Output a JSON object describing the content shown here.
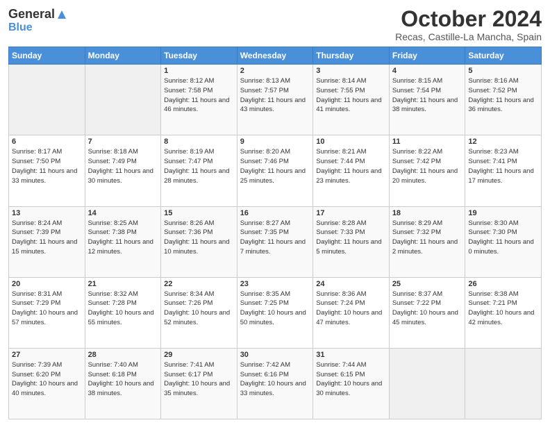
{
  "header": {
    "logo_general": "General",
    "logo_blue": "Blue",
    "month_title": "October 2024",
    "location": "Recas, Castille-La Mancha, Spain"
  },
  "weekdays": [
    "Sunday",
    "Monday",
    "Tuesday",
    "Wednesday",
    "Thursday",
    "Friday",
    "Saturday"
  ],
  "weeks": [
    [
      {
        "day": "",
        "info": ""
      },
      {
        "day": "",
        "info": ""
      },
      {
        "day": "1",
        "info": "Sunrise: 8:12 AM\nSunset: 7:58 PM\nDaylight: 11 hours and 46 minutes."
      },
      {
        "day": "2",
        "info": "Sunrise: 8:13 AM\nSunset: 7:57 PM\nDaylight: 11 hours and 43 minutes."
      },
      {
        "day": "3",
        "info": "Sunrise: 8:14 AM\nSunset: 7:55 PM\nDaylight: 11 hours and 41 minutes."
      },
      {
        "day": "4",
        "info": "Sunrise: 8:15 AM\nSunset: 7:54 PM\nDaylight: 11 hours and 38 minutes."
      },
      {
        "day": "5",
        "info": "Sunrise: 8:16 AM\nSunset: 7:52 PM\nDaylight: 11 hours and 36 minutes."
      }
    ],
    [
      {
        "day": "6",
        "info": "Sunrise: 8:17 AM\nSunset: 7:50 PM\nDaylight: 11 hours and 33 minutes."
      },
      {
        "day": "7",
        "info": "Sunrise: 8:18 AM\nSunset: 7:49 PM\nDaylight: 11 hours and 30 minutes."
      },
      {
        "day": "8",
        "info": "Sunrise: 8:19 AM\nSunset: 7:47 PM\nDaylight: 11 hours and 28 minutes."
      },
      {
        "day": "9",
        "info": "Sunrise: 8:20 AM\nSunset: 7:46 PM\nDaylight: 11 hours and 25 minutes."
      },
      {
        "day": "10",
        "info": "Sunrise: 8:21 AM\nSunset: 7:44 PM\nDaylight: 11 hours and 23 minutes."
      },
      {
        "day": "11",
        "info": "Sunrise: 8:22 AM\nSunset: 7:42 PM\nDaylight: 11 hours and 20 minutes."
      },
      {
        "day": "12",
        "info": "Sunrise: 8:23 AM\nSunset: 7:41 PM\nDaylight: 11 hours and 17 minutes."
      }
    ],
    [
      {
        "day": "13",
        "info": "Sunrise: 8:24 AM\nSunset: 7:39 PM\nDaylight: 11 hours and 15 minutes."
      },
      {
        "day": "14",
        "info": "Sunrise: 8:25 AM\nSunset: 7:38 PM\nDaylight: 11 hours and 12 minutes."
      },
      {
        "day": "15",
        "info": "Sunrise: 8:26 AM\nSunset: 7:36 PM\nDaylight: 11 hours and 10 minutes."
      },
      {
        "day": "16",
        "info": "Sunrise: 8:27 AM\nSunset: 7:35 PM\nDaylight: 11 hours and 7 minutes."
      },
      {
        "day": "17",
        "info": "Sunrise: 8:28 AM\nSunset: 7:33 PM\nDaylight: 11 hours and 5 minutes."
      },
      {
        "day": "18",
        "info": "Sunrise: 8:29 AM\nSunset: 7:32 PM\nDaylight: 11 hours and 2 minutes."
      },
      {
        "day": "19",
        "info": "Sunrise: 8:30 AM\nSunset: 7:30 PM\nDaylight: 11 hours and 0 minutes."
      }
    ],
    [
      {
        "day": "20",
        "info": "Sunrise: 8:31 AM\nSunset: 7:29 PM\nDaylight: 10 hours and 57 minutes."
      },
      {
        "day": "21",
        "info": "Sunrise: 8:32 AM\nSunset: 7:28 PM\nDaylight: 10 hours and 55 minutes."
      },
      {
        "day": "22",
        "info": "Sunrise: 8:34 AM\nSunset: 7:26 PM\nDaylight: 10 hours and 52 minutes."
      },
      {
        "day": "23",
        "info": "Sunrise: 8:35 AM\nSunset: 7:25 PM\nDaylight: 10 hours and 50 minutes."
      },
      {
        "day": "24",
        "info": "Sunrise: 8:36 AM\nSunset: 7:24 PM\nDaylight: 10 hours and 47 minutes."
      },
      {
        "day": "25",
        "info": "Sunrise: 8:37 AM\nSunset: 7:22 PM\nDaylight: 10 hours and 45 minutes."
      },
      {
        "day": "26",
        "info": "Sunrise: 8:38 AM\nSunset: 7:21 PM\nDaylight: 10 hours and 42 minutes."
      }
    ],
    [
      {
        "day": "27",
        "info": "Sunrise: 7:39 AM\nSunset: 6:20 PM\nDaylight: 10 hours and 40 minutes."
      },
      {
        "day": "28",
        "info": "Sunrise: 7:40 AM\nSunset: 6:18 PM\nDaylight: 10 hours and 38 minutes."
      },
      {
        "day": "29",
        "info": "Sunrise: 7:41 AM\nSunset: 6:17 PM\nDaylight: 10 hours and 35 minutes."
      },
      {
        "day": "30",
        "info": "Sunrise: 7:42 AM\nSunset: 6:16 PM\nDaylight: 10 hours and 33 minutes."
      },
      {
        "day": "31",
        "info": "Sunrise: 7:44 AM\nSunset: 6:15 PM\nDaylight: 10 hours and 30 minutes."
      },
      {
        "day": "",
        "info": ""
      },
      {
        "day": "",
        "info": ""
      }
    ]
  ]
}
